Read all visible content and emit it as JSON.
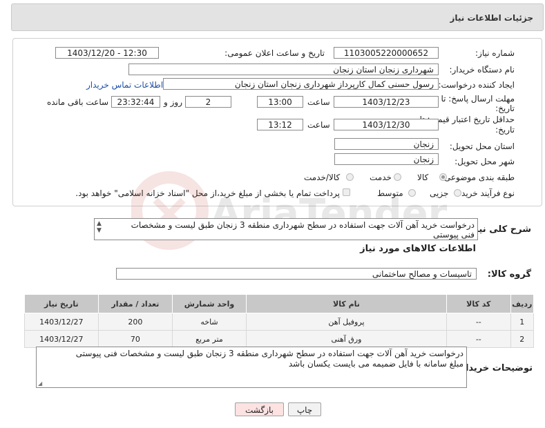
{
  "header": {
    "title": "جزئیات اطلاعات نیاز"
  },
  "form": {
    "need_number_label": "شماره نیاز:",
    "need_number": "1103005220000652",
    "announce_label": "تاریخ و ساعت اعلان عمومی:",
    "announce_value": "1403/12/20 - 12:30",
    "buyer_org_label": "نام دستگاه خریدار:",
    "buyer_org": "شهرداری زنجان استان زنجان",
    "creator_label": "ایجاد کننده درخواست:",
    "creator": "رسول حسنی کمال کارپرداز شهرداری زنجان استان زنجان",
    "contact_link": "اطلاعات تماس خریدار",
    "deadline_label_1": "مهلت ارسال پاسخ: تا",
    "deadline_label_2": "تاریخ:",
    "deadline_date": "1403/12/23",
    "time_label": "ساعت",
    "deadline_time": "13:00",
    "days_value": "2",
    "days_label": "روز و",
    "remaining_time": "23:32:44",
    "remaining_label": "ساعت باقی مانده",
    "validity_label_1": "حداقل تاریخ اعتبار قیمت: تا",
    "validity_label_2": "تاریخ:",
    "validity_date": "1403/12/30",
    "validity_time": "13:12",
    "province_label": "استان محل تحویل:",
    "province": "زنجان",
    "city_label": "شهر محل تحویل:",
    "city": "زنجان",
    "category_label": "طبقه بندی موضوعی:",
    "category_options": [
      "کالا",
      "خدمت",
      "کالا/خدمت"
    ],
    "category_selected": "کالا",
    "process_label": "نوع فرآیند خرید :",
    "process_options": [
      "جزیی",
      "متوسط"
    ],
    "payment_note": "پرداخت تمام یا بخشی از مبلغ خرید،از محل \"اسناد خزانه اسلامی\" خواهد بود."
  },
  "description": {
    "label": "شرح کلی نیاز:",
    "text": "درخواست خرید آهن آلات جهت استفاده در سطح شهرداری منطقه 3 زنجان طبق لیست و مشخصات فنی پیوستی"
  },
  "goods": {
    "section_title": "اطلاعات کالاهای مورد نیاز",
    "group_label": "گروه کالا:",
    "group_value": "تاسیسات و مصالح ساختمانی",
    "columns": [
      "ردیف",
      "کد کالا",
      "نام کالا",
      "واحد شمارش",
      "تعداد / مقدار",
      "تاریخ نیاز"
    ],
    "rows": [
      [
        "1",
        "--",
        "پروفیل آهن",
        "شاخه",
        "200",
        "1403/12/27"
      ],
      [
        "2",
        "--",
        "ورق آهنی",
        "متر مربع",
        "70",
        "1403/12/27"
      ]
    ]
  },
  "buyer_notes": {
    "label": "توضیحات خریدار:",
    "text": "درخواست خرید آهن آلات جهت استفاده در سطح شهرداری منطقه 3 زنجان طبق لیست و مشخصات فنی پیوستی مبلغ سامانه با فایل ضمیمه می بایست یکسان باشد"
  },
  "buttons": {
    "print": "چاپ",
    "back": "بازگشت"
  },
  "watermark": {
    "text": "AriaTender.net"
  }
}
